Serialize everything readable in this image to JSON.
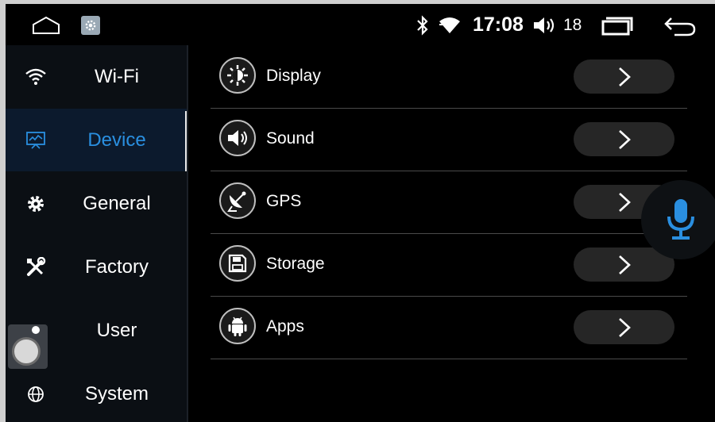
{
  "status_bar": {
    "time": "17:08",
    "volume_level": "18",
    "icons": [
      "home-icon",
      "settings-icon",
      "bluetooth-icon",
      "wifi-signal-icon",
      "volume-icon",
      "recents-icon",
      "back-icon"
    ]
  },
  "sidebar": {
    "items": [
      {
        "label": "Wi-Fi",
        "icon": "wifi-icon",
        "active": false
      },
      {
        "label": "Device",
        "icon": "device-monitor-icon",
        "active": true
      },
      {
        "label": "General",
        "icon": "gear-icon",
        "active": false
      },
      {
        "label": "Factory",
        "icon": "tools-icon",
        "active": false
      },
      {
        "label": "User",
        "icon": "user-icon",
        "active": false
      },
      {
        "label": "System",
        "icon": "globe-icon",
        "active": false
      }
    ]
  },
  "settings_list": {
    "items": [
      {
        "label": "Display",
        "icon": "brightness-icon"
      },
      {
        "label": "Sound",
        "icon": "speaker-icon"
      },
      {
        "label": "GPS",
        "icon": "satellite-dish-icon"
      },
      {
        "label": "Storage",
        "icon": "floppy-disk-icon"
      },
      {
        "label": "Apps",
        "icon": "android-icon"
      }
    ]
  },
  "colors": {
    "background": "#000000",
    "sidebar_bg": "#0b0f14",
    "active_bg": "#0c1a2d",
    "accent": "#2a8fe0",
    "row_button": "#262626"
  }
}
